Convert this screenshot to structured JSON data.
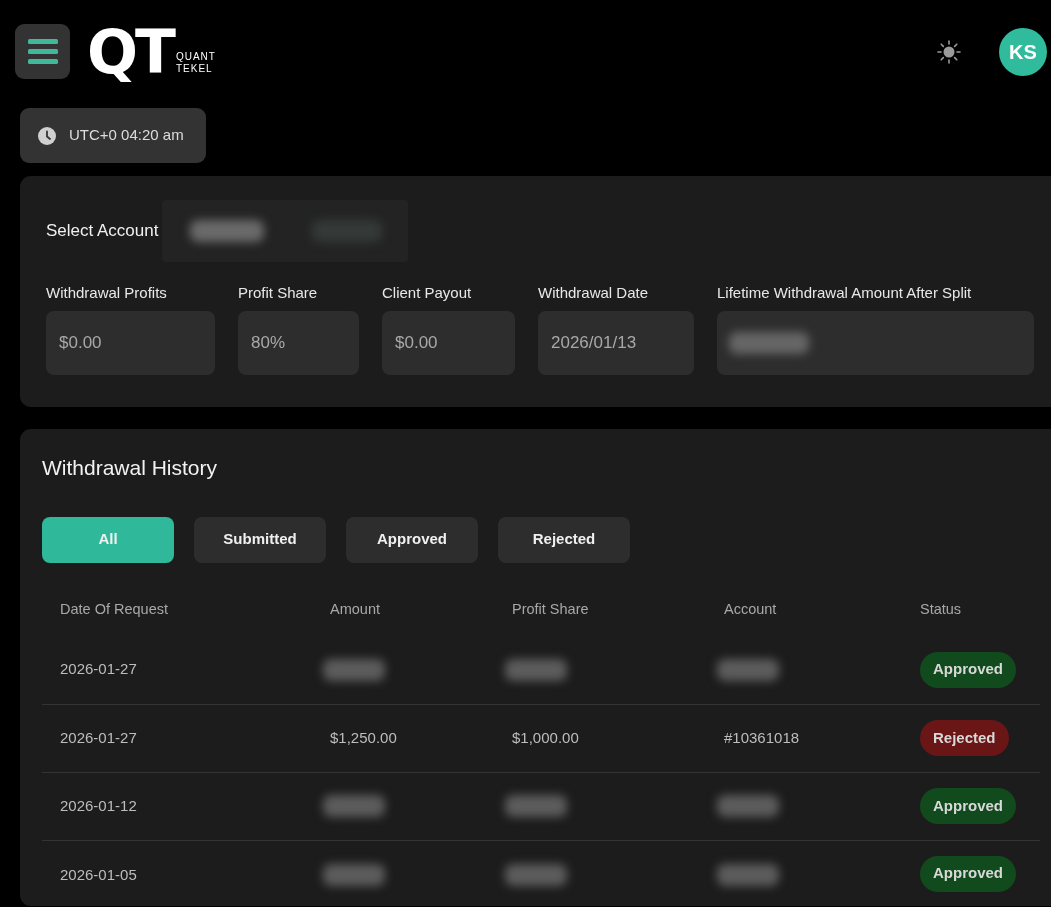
{
  "header": {
    "logo": {
      "mark": "QT",
      "subtitle_lines": [
        "QUANT",
        "TEKEL"
      ]
    },
    "avatar": {
      "initials": "KS"
    }
  },
  "clock": {
    "text": "UTC+0 04:20 am"
  },
  "account_panel": {
    "select_label": "Select Account",
    "select_redacted": true,
    "fields": [
      {
        "label": "Withdrawal Profits",
        "value": "$0.00",
        "redacted": false
      },
      {
        "label": "Profit Share",
        "value": "80%",
        "redacted": false
      },
      {
        "label": "Client Payout",
        "value": "$0.00",
        "redacted": false
      },
      {
        "label": "Withdrawal Date",
        "value": "2026/01/13",
        "redacted": false
      },
      {
        "label": "Lifetime Withdrawal Amount After Split",
        "redacted": true
      }
    ]
  },
  "history": {
    "title": "Withdrawal History",
    "filters": [
      {
        "label": "All",
        "selected": true
      },
      {
        "label": "Submitted",
        "selected": false
      },
      {
        "label": "Approved",
        "selected": false
      },
      {
        "label": "Rejected",
        "selected": false
      }
    ],
    "columns": [
      "Date Of Request",
      "Amount",
      "Profit Share",
      "Account",
      "Status"
    ],
    "rows": [
      {
        "date": "2026-01-27",
        "redacted": true,
        "status": {
          "label": "Approved",
          "color": "#114a1c"
        }
      },
      {
        "date": "2026-01-27",
        "redacted": false,
        "amount": "$1,250.00",
        "profit_share": "$1,000.00",
        "account": "#10361018",
        "status": {
          "label": "Rejected",
          "color": "#6a1616"
        }
      },
      {
        "date": "2026-01-12",
        "redacted": true,
        "status": {
          "label": "Approved",
          "color": "#114a1c"
        }
      },
      {
        "date": "2026-01-05",
        "redacted": true,
        "status": {
          "label": "Approved",
          "color": "#114a1c"
        }
      }
    ]
  }
}
